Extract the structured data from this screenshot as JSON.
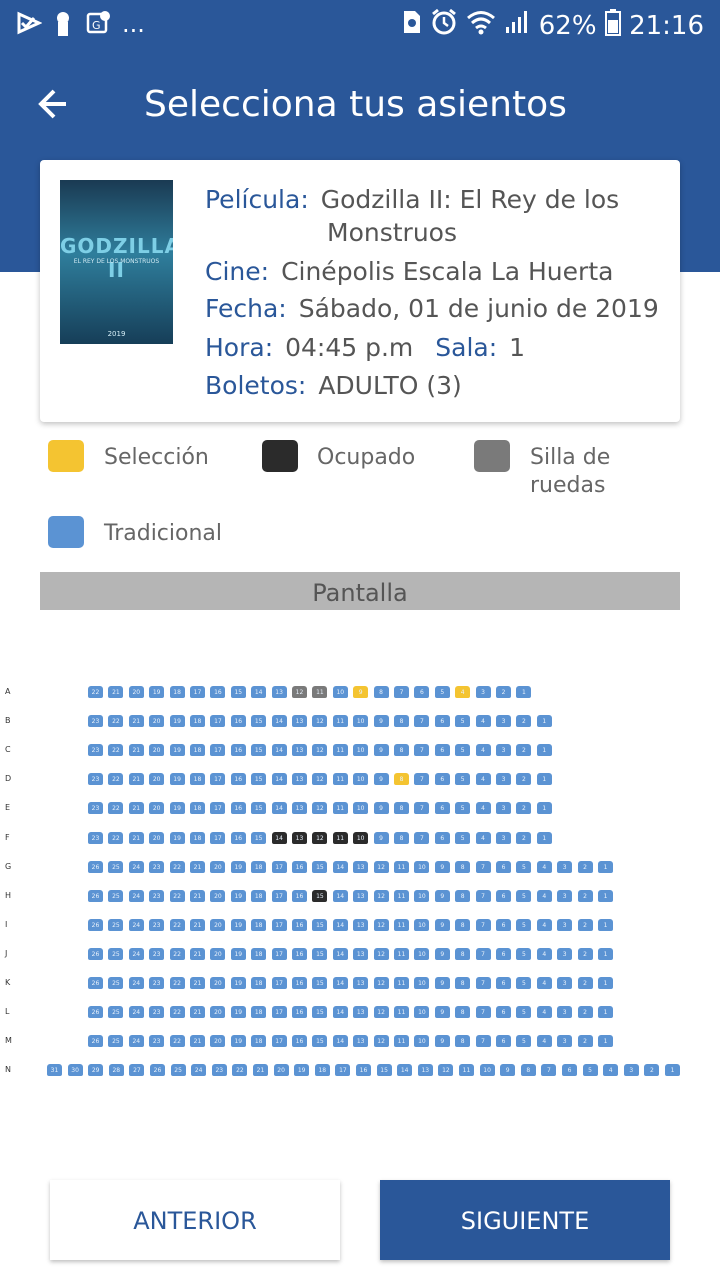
{
  "status_bar": {
    "battery": "62%",
    "time": "21:16",
    "dots": "..."
  },
  "header": {
    "title": "Selecciona tus asientos"
  },
  "card": {
    "poster": {
      "title": "GODZILLA II",
      "subtitle": "EL REY DE LOS MONSTRUOS",
      "year": "2019"
    },
    "pelicula_label": "Película:",
    "pelicula_value_line1": "Godzilla II: El Rey de los",
    "pelicula_value_line2": "Monstruos",
    "cine_label": "Cine:",
    "cine_value": "Cinépolis Escala La Huerta",
    "fecha_label": "Fecha:",
    "fecha_value": "Sábado, 01 de junio de 2019",
    "hora_label": "Hora:",
    "hora_value": "04:45 p.m",
    "sala_label": "Sala:",
    "sala_value": "1",
    "boletos_label": "Boletos:",
    "boletos_value": "ADULTO (3)"
  },
  "legend": {
    "seleccion": "Selección",
    "ocupado": "Ocupado",
    "silla_line1": "Silla de",
    "silla_line2": "ruedas",
    "tradicional": "Tradicional"
  },
  "screen_label": "Pantalla",
  "colors": {
    "primary": "#2a5799",
    "seat_available": "#5b93d3",
    "seat_selected": "#f4c431",
    "seat_occupied": "#2b2b2b",
    "seat_wheelchair": "#7a7a7a"
  },
  "seatmap": {
    "rows": [
      {
        "label": "A",
        "seats": 22,
        "width_seats": 22,
        "sold": [],
        "selected": [
          9,
          4
        ],
        "wheelchair": [
          12,
          11
        ]
      },
      {
        "label": "B",
        "seats": 23,
        "width_seats": 23,
        "sold": [],
        "selected": [],
        "wheelchair": []
      },
      {
        "label": "C",
        "seats": 23,
        "width_seats": 23,
        "sold": [],
        "selected": [],
        "wheelchair": []
      },
      {
        "label": "D",
        "seats": 23,
        "width_seats": 23,
        "sold": [],
        "selected": [
          8
        ],
        "wheelchair": []
      },
      {
        "label": "E",
        "seats": 23,
        "width_seats": 23,
        "sold": [],
        "selected": [],
        "wheelchair": []
      },
      {
        "label": "F",
        "seats": 23,
        "width_seats": 23,
        "sold": [
          14,
          13,
          12,
          11,
          10
        ],
        "selected": [],
        "wheelchair": []
      },
      {
        "label": "G",
        "seats": 26,
        "width_seats": 26,
        "sold": [],
        "selected": [],
        "wheelchair": []
      },
      {
        "label": "H",
        "seats": 26,
        "width_seats": 26,
        "sold": [
          15
        ],
        "selected": [],
        "wheelchair": []
      },
      {
        "label": "I",
        "seats": 26,
        "width_seats": 26,
        "sold": [],
        "selected": [],
        "wheelchair": []
      },
      {
        "label": "J",
        "seats": 26,
        "width_seats": 26,
        "sold": [],
        "selected": [],
        "wheelchair": []
      },
      {
        "label": "K",
        "seats": 26,
        "width_seats": 26,
        "sold": [],
        "selected": [],
        "wheelchair": []
      },
      {
        "label": "L",
        "seats": 26,
        "width_seats": 26,
        "sold": [],
        "selected": [],
        "wheelchair": []
      },
      {
        "label": "M",
        "seats": 26,
        "width_seats": 26,
        "sold": [],
        "selected": [],
        "wheelchair": []
      },
      {
        "label": "N",
        "seats": 31,
        "width_seats": 31,
        "sold": [],
        "selected": [],
        "wheelchair": []
      }
    ]
  },
  "buttons": {
    "prev": "ANTERIOR",
    "next": "SIGUIENTE"
  }
}
